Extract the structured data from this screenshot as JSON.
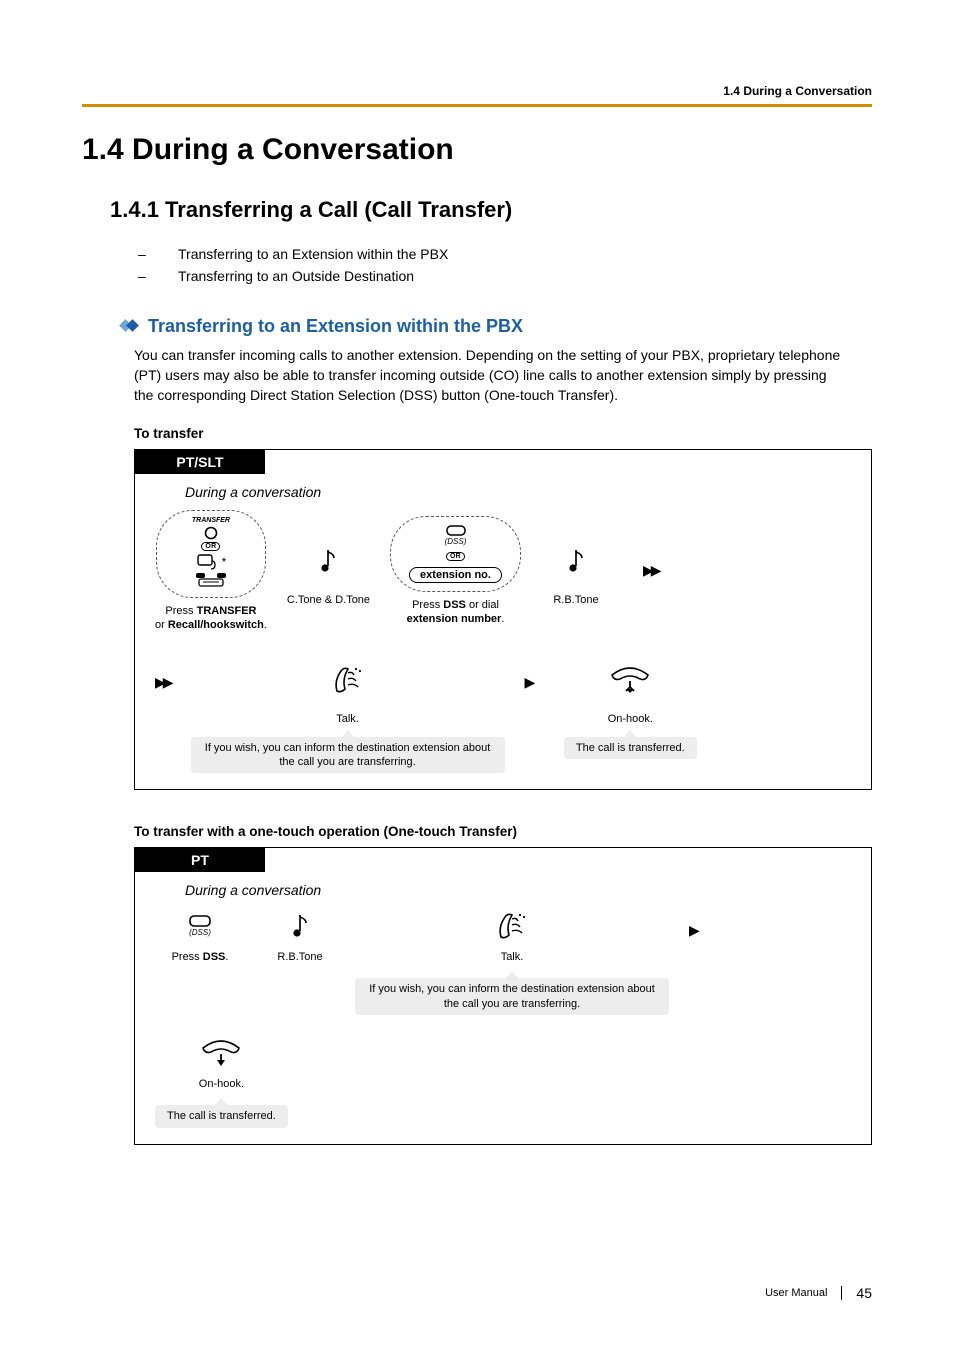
{
  "runningHead": "1.4 During a Conversation",
  "h1": "1.4    During a Conversation",
  "h2": "1.4.1    Transferring a Call (Call Transfer)",
  "toc": [
    "Transferring to an Extension within the PBX",
    "Transferring to an Outside Destination"
  ],
  "h3": "Transferring to an Extension within the PBX",
  "intro": "You can transfer incoming calls to another extension. Depending on the setting of your PBX, proprietary telephone (PT) users may also be able to transfer incoming outside (CO) line calls to another extension simply by pressing the corresponding Direct Station Selection (DSS) button (One-touch Transfer).",
  "sub1": "To transfer",
  "flow1": {
    "tab": "PT/SLT",
    "context": "During a conversation",
    "transferLabel": "TRANSFER",
    "or": "OR",
    "step1Line1Pre": "Press ",
    "step1Line1Bold": "TRANSFER",
    "step1Line2Pre": "or ",
    "step1Line2Bold": "Recall/hookswitch",
    "step1Line2Post": ".",
    "tone1": "C.Tone & D.Tone",
    "dssSmall": "(DSS)",
    "extNo": "extension no.",
    "step2Line1Pre": "Press ",
    "step2Line1Bold": "DSS",
    "step2Line1Post": " or dial",
    "step2Line2Bold": "extension number",
    "step2Line2Post": ".",
    "tone2": "R.B.Tone",
    "talk": "Talk.",
    "onhook": "On-hook.",
    "note1": "If you wish, you can inform the destination extension about the call you are transferring.",
    "note2": "The call is transferred."
  },
  "sub2": "To transfer with a one-touch operation (One-touch Transfer)",
  "flow2": {
    "tab": "PT",
    "context": "During a conversation",
    "dssSmall": "(DSS)",
    "step1Pre": "Press ",
    "step1Bold": "DSS",
    "step1Post": ".",
    "tone": "R.B.Tone",
    "talk": "Talk.",
    "onhook": "On-hook.",
    "note1": "If you wish, you can inform the destination extension about the call you are transferring.",
    "note2": "The call is transferred."
  },
  "footer": {
    "manual": "User Manual",
    "page": "45"
  }
}
